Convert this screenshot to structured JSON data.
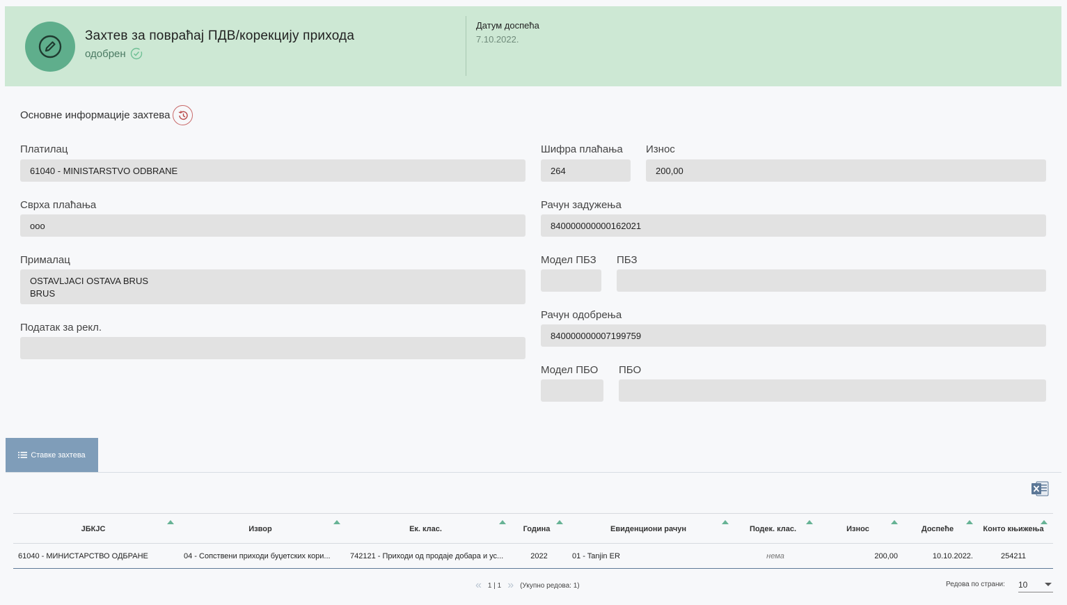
{
  "header": {
    "title": "Захтев за повраћај ПДВ/корекцију прихода",
    "status": "одобрен",
    "due_label": "Датум доспећа",
    "due_value": "7.10.2022."
  },
  "section": {
    "title": "Основне информације захтева"
  },
  "form": {
    "payer": {
      "label": "Платилац",
      "value": "61040 - MINISTARSTVO ODBRANE"
    },
    "payment_code": {
      "label": "Шифра плаћања",
      "value": "264"
    },
    "amount": {
      "label": "Износ",
      "value": "200,00"
    },
    "purpose": {
      "label": "Сврха плаћања",
      "value": "ooo"
    },
    "debit_account": {
      "label": "Рачун задужења",
      "value": "840000000000162021"
    },
    "recipient": {
      "label": "Прималац",
      "value": "OSTAVLJACI OSTAVA BRUS\nBRUS"
    },
    "model_pbz": {
      "label": "Модел ПБЗ",
      "value": ""
    },
    "pbz": {
      "label": "ПБЗ",
      "value": ""
    },
    "complaint_data": {
      "label": "Податак за рекл.",
      "value": ""
    },
    "credit_account": {
      "label": "Рачун одобрења",
      "value": "840000000007199759"
    },
    "model_pbo": {
      "label": "Модел ПБО",
      "value": ""
    },
    "pbo": {
      "label": "ПБО",
      "value": ""
    }
  },
  "tab": {
    "label": "Ставке захтева"
  },
  "table": {
    "headers": [
      "ЈБКЈС",
      "Извор",
      "Ек. клас.",
      "Година",
      "Евиденциони рачун",
      "Подек. клас.",
      "Износ",
      "Доспеће",
      "Конто књижења"
    ],
    "rows": [
      [
        "61040 - МИНИСТАРСТВО ОДБРАНЕ",
        "04 - Сопствени приходи буџетских кори...",
        "742121 - Приходи од продаје добара и ус...",
        "2022",
        "01 - Tanjin ER",
        "нема",
        "200,00",
        "10.10.2022.",
        "254211"
      ]
    ]
  },
  "pagination": {
    "page": "1 | 1",
    "total": "(Укупно редова: 1)",
    "rows_per_page_label": "Редова по страни:",
    "rows_per_page": "10"
  },
  "colors": {
    "header_bg": "#cde8d4",
    "accent": "#5fae8c",
    "tab": "#7f9db9"
  }
}
